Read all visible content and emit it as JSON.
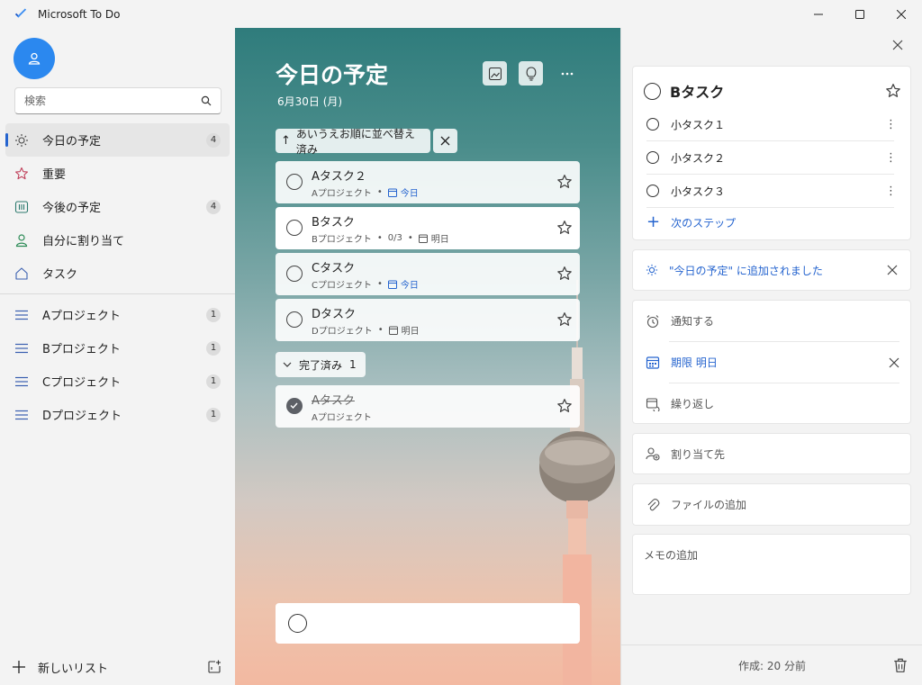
{
  "window": {
    "title": "Microsoft To Do",
    "controls": [
      "minimize",
      "maximize",
      "close"
    ]
  },
  "sidebar": {
    "search_placeholder": "検索",
    "items": [
      {
        "label": "今日の予定",
        "count": "4",
        "icon": "sun-icon",
        "active": true
      },
      {
        "label": "重要",
        "count": "",
        "icon": "star-icon"
      },
      {
        "label": "今後の予定",
        "count": "4",
        "icon": "calendar-grid-icon"
      },
      {
        "label": "自分に割り当て",
        "count": "",
        "icon": "person-icon"
      },
      {
        "label": "タスク",
        "count": "",
        "icon": "home-icon"
      }
    ],
    "lists": [
      {
        "label": "Aプロジェクト",
        "count": "1"
      },
      {
        "label": "Bプロジェクト",
        "count": "1"
      },
      {
        "label": "Cプロジェクト",
        "count": "1"
      },
      {
        "label": "Dプロジェクト",
        "count": "1"
      }
    ],
    "new_list_label": "新しいリスト"
  },
  "main": {
    "title": "今日の予定",
    "date": "6月30日 (月)",
    "sort_label": "あいうえお順に並べ替え済み",
    "tasks": [
      {
        "title": "Aタスク２",
        "project": "Aプロジェクト",
        "progress": "",
        "due": "今日",
        "due_today": true
      },
      {
        "title": "Bタスク",
        "project": "Bプロジェクト",
        "progress": "0/3",
        "due": "明日",
        "due_today": false
      },
      {
        "title": "Cタスク",
        "project": "Cプロジェクト",
        "progress": "",
        "due": "今日",
        "due_today": true
      },
      {
        "title": "Dタスク",
        "project": "Dプロジェクト",
        "progress": "",
        "due": "明日",
        "due_today": false
      }
    ],
    "completed_label": "完了済み",
    "completed_count": "1",
    "completed_tasks": [
      {
        "title": "Aタスク",
        "project": "Aプロジェクト"
      }
    ]
  },
  "details": {
    "title": "Bタスク",
    "steps": [
      "小タスク１",
      "小タスク２",
      "小タスク３"
    ],
    "next_step_label": "次のステップ",
    "added_to_today": "\"今日の予定\" に追加されました",
    "remind_label": "通知する",
    "due_label": "期限 明日",
    "repeat_label": "繰り返し",
    "assign_label": "割り当て先",
    "file_label": "ファイルの追加",
    "note_placeholder": "メモの追加",
    "created_label": "作成: 20 分前"
  },
  "colors": {
    "accent": "#2564cf",
    "avatar": "#2b88ef"
  }
}
